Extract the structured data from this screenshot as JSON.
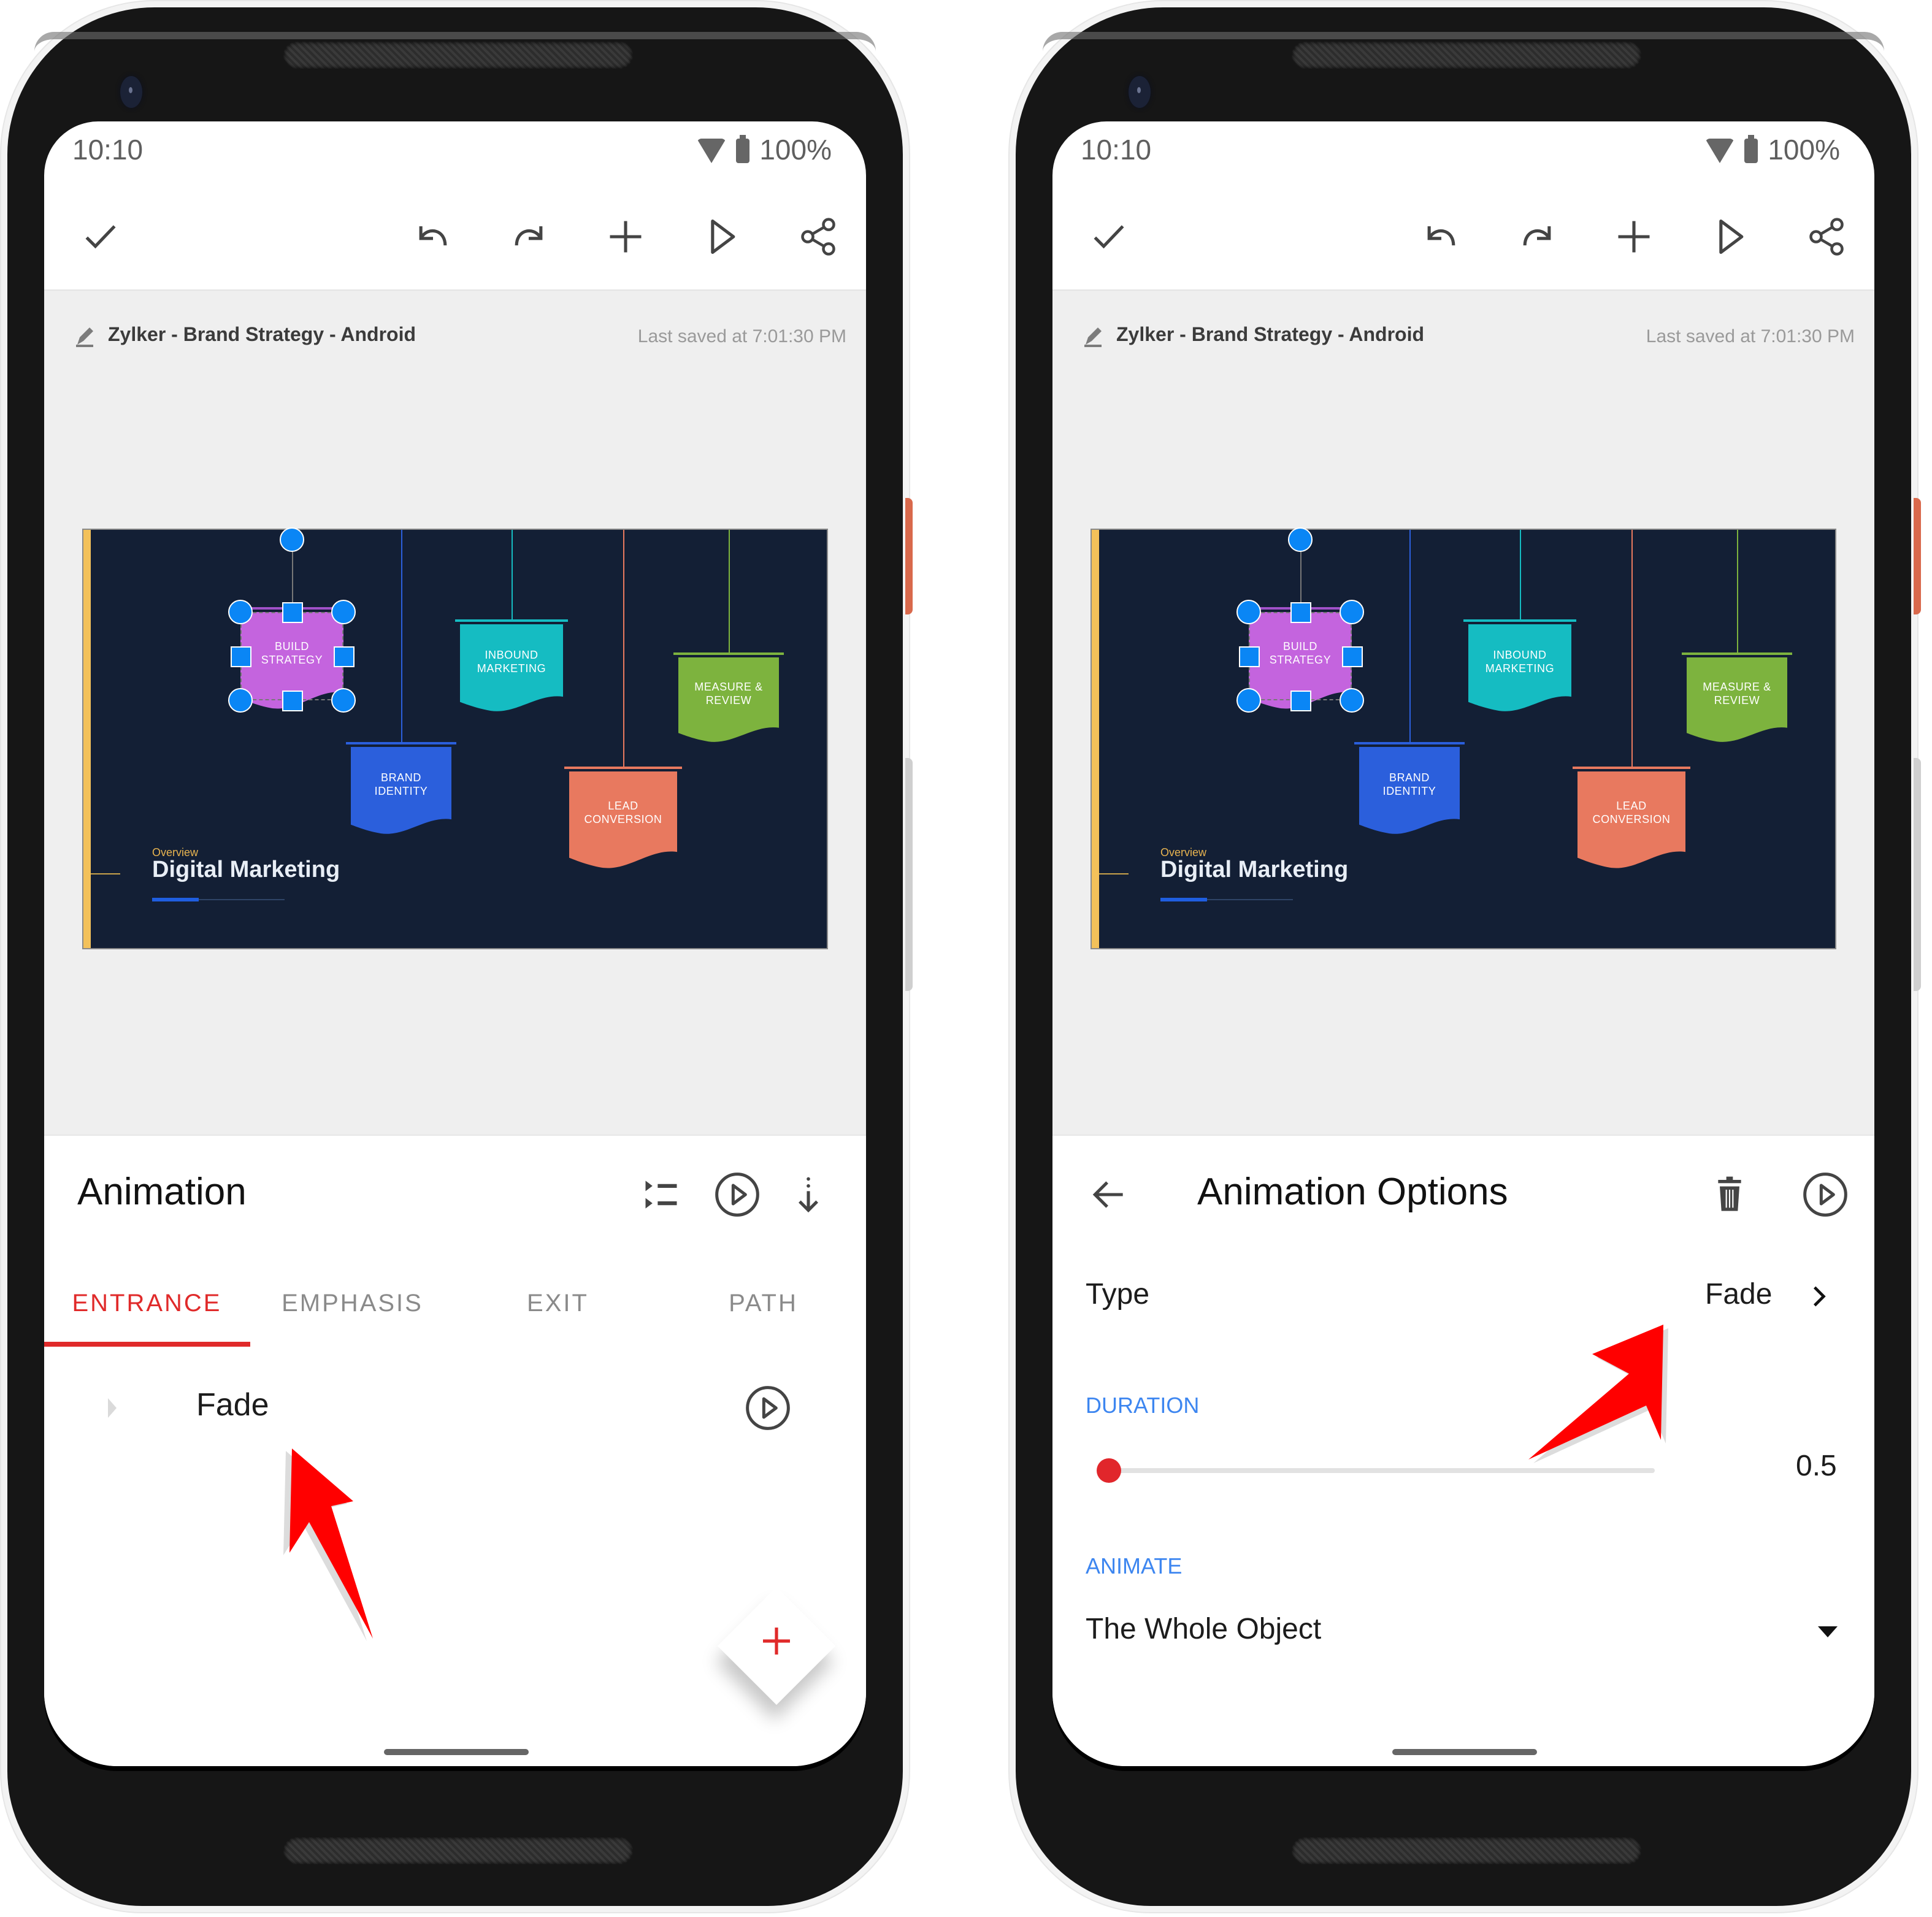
{
  "status_bar": {
    "time": "10:10",
    "battery": "100%"
  },
  "toolbar": {
    "icons": [
      "check-icon",
      "undo-icon",
      "redo-icon",
      "add-icon",
      "play-icon",
      "share-icon"
    ]
  },
  "document": {
    "title": "Zylker - Brand Strategy - Android",
    "last_saved": "Last saved at 7:01:30 PM"
  },
  "slide": {
    "background": "#131f35",
    "subtitle": "Overview",
    "title": "Digital Marketing",
    "progress": 0.35,
    "shapes": [
      {
        "label_1": "BUILD",
        "label_2": "STRATEGY",
        "color": "#c464de",
        "selected": true
      },
      {
        "label_1": "BRAND",
        "label_2": "IDENTITY",
        "color": "#2b5fdc"
      },
      {
        "label_1": "INBOUND",
        "label_2": "MARKETING",
        "color": "#15bcc2"
      },
      {
        "label_1": "LEAD",
        "label_2": "CONVERSION",
        "color": "#e8795f"
      },
      {
        "label_1": "MEASURE &",
        "label_2": "REVIEW",
        "color": "#7db33e"
      }
    ]
  },
  "left_panel": {
    "title": "Animation",
    "tabs": [
      {
        "label": "ENTRANCE",
        "active": true
      },
      {
        "label": "EMPHASIS",
        "active": false
      },
      {
        "label": "EXIT",
        "active": false
      },
      {
        "label": "PATH",
        "active": false
      }
    ],
    "animations": [
      {
        "name": "Fade"
      }
    ]
  },
  "right_panel": {
    "title": "Animation Options",
    "type_label": "Type",
    "type_value": "Fade",
    "duration_label": "DURATION",
    "duration_value": "0.5",
    "duration_fraction": 0.0,
    "animate_label": "ANIMATE",
    "animate_value": "The Whole Object"
  },
  "colors": {
    "accent_red": "#e02a2a",
    "section_blue": "#3d86f0",
    "handle_blue": "#0a86f5",
    "annotation_arrow": "#ff0000"
  }
}
